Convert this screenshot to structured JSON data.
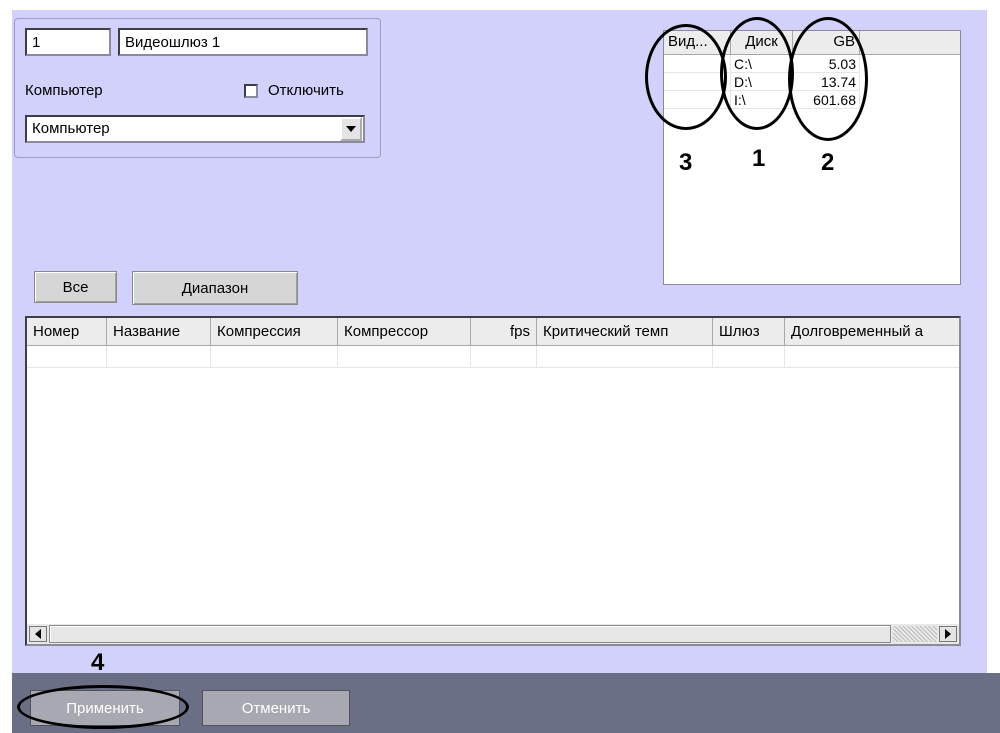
{
  "gateway": {
    "id_value": "1",
    "name_value": "Видеошлюз 1",
    "computer_label": "Компьютер",
    "disable_label": "Отключить",
    "computer_select_value": "Компьютер"
  },
  "disk_table": {
    "headers": [
      "Вид...",
      "Диск",
      "GB"
    ],
    "rows": [
      {
        "drive": "C:\\",
        "gb": "5.03"
      },
      {
        "drive": "D:\\",
        "gb": "13.74"
      },
      {
        "drive": "I:\\",
        "gb": "601.68"
      }
    ]
  },
  "annotations": {
    "n1": "1",
    "n2": "2",
    "n3": "3",
    "n4": "4"
  },
  "range_buttons": {
    "all": "Все",
    "range": "Диапазон"
  },
  "camera_table": {
    "columns": [
      "Номер",
      "Название",
      "Компрессия",
      "Компрессор",
      "fps",
      "Критический темп",
      "Шлюз",
      "Долговременный а"
    ]
  },
  "footer": {
    "apply": "Применить",
    "cancel": "Отменить"
  }
}
